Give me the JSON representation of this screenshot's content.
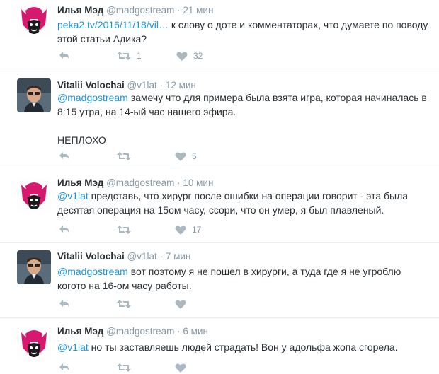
{
  "tweets": [
    {
      "name": "Илья Мэд",
      "handle": "@madgostream",
      "dot": "·",
      "time": "21 мин",
      "link": "peka2.tv/2016/11/18/vil…",
      "text_after_link": " к слову о доте и комментаторах, что думаете по поводу этой статьи Адика?",
      "retweets": "1",
      "likes": "32"
    },
    {
      "name": "Vitalii Volochai",
      "handle": "@v1lat",
      "dot": "·",
      "time": "12 мин",
      "mention": "@madgostream",
      "text_after_mention": " замечу что для примера была взята игра, которая начиналась в 8:15 утра, на 14-ый час нашего эфира.",
      "text_extra": "НЕПЛОХО",
      "retweets": "",
      "likes": "5"
    },
    {
      "name": "Илья Мэд",
      "handle": "@madgostream",
      "dot": "·",
      "time": "10 мин",
      "mention": "@v1lat",
      "text_after_mention": " представь, что хирург после ошибки на операции говорит - эта была десятая операция на 15ом часу, ссори, что он умер, я был плавленый.",
      "retweets": "",
      "likes": "17"
    },
    {
      "name": "Vitalii Volochai",
      "handle": "@v1lat",
      "dot": "·",
      "time": "7 мин",
      "mention": "@madgostream",
      "text_after_mention": " вот поэтому я не пошел в хирурги, а туда где я не угроблю когото на 16-ом часу работы.",
      "retweets": "",
      "likes": ""
    },
    {
      "name": "Илья Мэд",
      "handle": "@madgostream",
      "dot": "·",
      "time": "6 мин",
      "mention": "@v1lat",
      "text_after_mention": " но ты заставляешь людей страдать! Вон у адольфа жопа сгорела.",
      "retweets": "",
      "likes": ""
    }
  ],
  "icons": {
    "reply": "reply-icon",
    "retweet": "retweet-icon",
    "like": "heart-icon"
  },
  "colors": {
    "link": "#1b95e0",
    "muted": "#8899a6",
    "text": "#292f33",
    "icon": "#aab8c2",
    "divider": "#e6ecf0"
  }
}
